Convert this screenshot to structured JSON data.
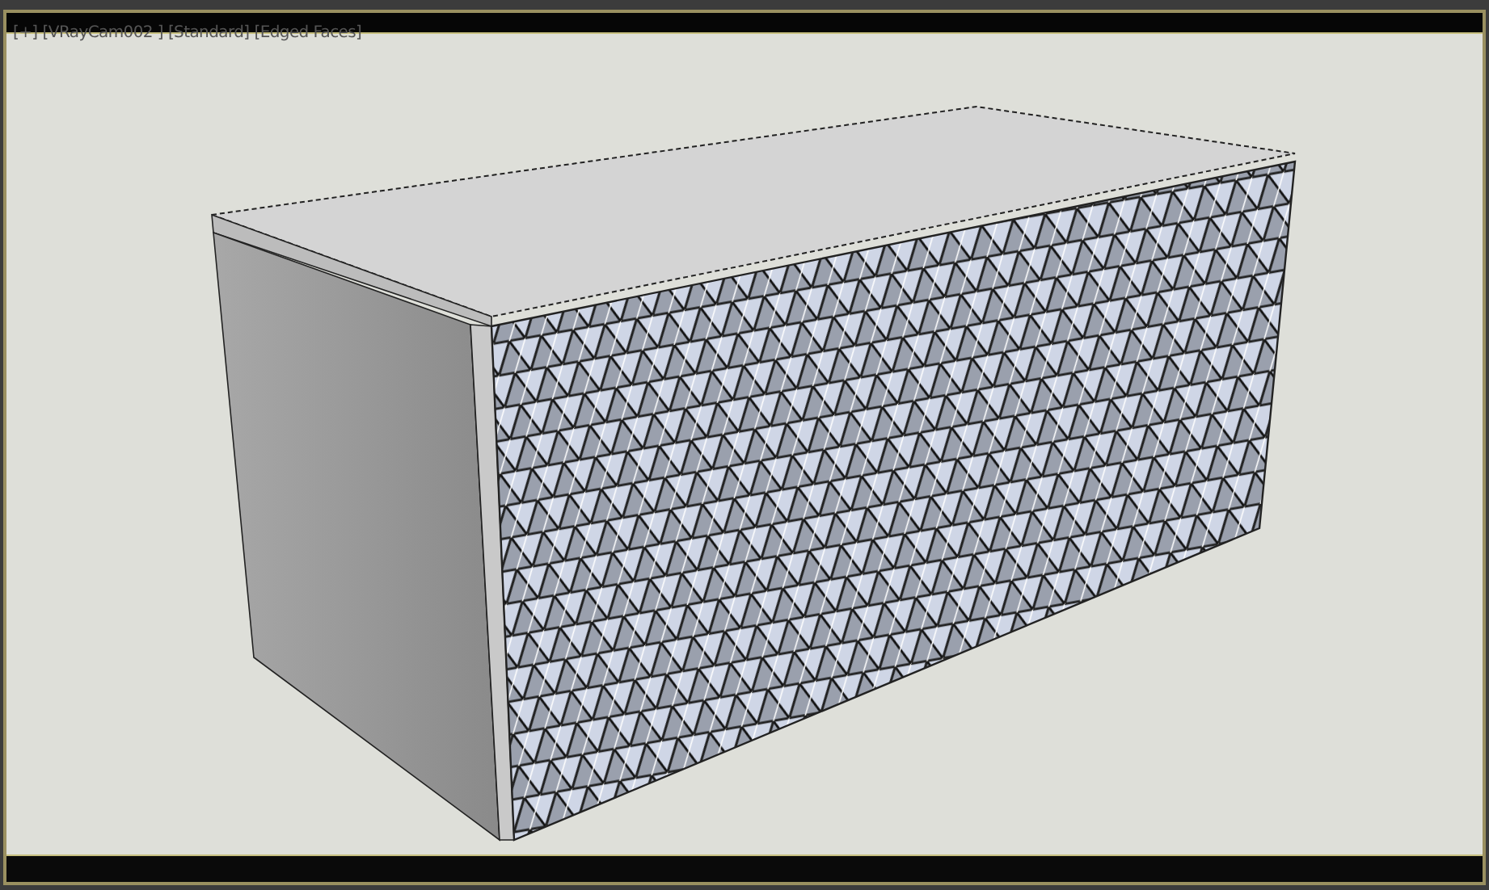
{
  "viewport": {
    "labels": [
      {
        "text": "[+]"
      },
      {
        "text": "[VRayCam002 ]"
      },
      {
        "text": "[Standard]"
      },
      {
        "text": "[Edged Faces]"
      }
    ]
  }
}
